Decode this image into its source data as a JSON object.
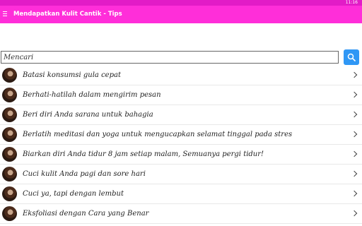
{
  "status_bar": {
    "time": "11:16"
  },
  "app_bar": {
    "title": "Mendapatkan Kulit Cantik - Tips"
  },
  "search": {
    "placeholder": "Mencari"
  },
  "items": [
    {
      "label": "Batasi konsumsi gula cepat"
    },
    {
      "label": "Berhati-hatilah dalam mengirim pesan"
    },
    {
      "label": "Beri diri Anda sarana untuk bahagia"
    },
    {
      "label": "Berlatih meditasi dan yoga untuk mengucapkan selamat tinggal pada stres"
    },
    {
      "label": "Biarkan diri Anda tidur 8 jam setiap malam, Semuanya pergi tidur!"
    },
    {
      "label": "Cuci kulit Anda pagi dan sore hari"
    },
    {
      "label": "Cuci ya, tapi dengan lembut"
    },
    {
      "label": "Eksfoliasi dengan Cara yang Benar"
    }
  ]
}
